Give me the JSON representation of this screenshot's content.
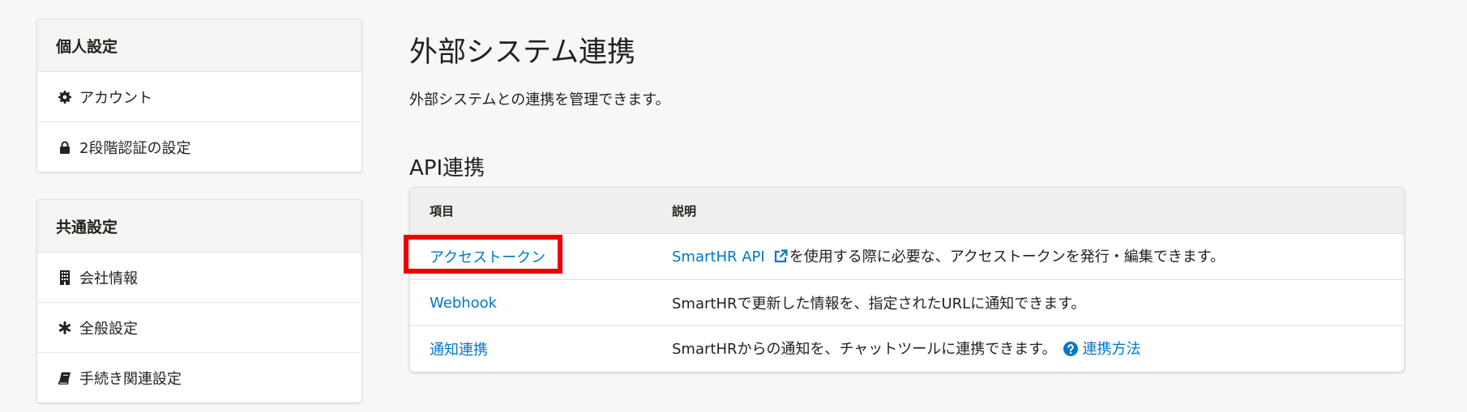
{
  "sidebar": {
    "personal": {
      "header": "個人設定",
      "items": [
        {
          "label": "アカウント",
          "icon": "gear-icon"
        },
        {
          "label": "2段階認証の設定",
          "icon": "lock-icon"
        }
      ]
    },
    "common": {
      "header": "共通設定",
      "items": [
        {
          "label": "会社情報",
          "icon": "building-icon"
        },
        {
          "label": "全般設定",
          "icon": "asterisk-icon"
        },
        {
          "label": "手続き関連設定",
          "icon": "book-icon"
        }
      ]
    }
  },
  "main": {
    "title": "外部システム連携",
    "description": "外部システムとの連携を管理できます。",
    "section_title": "API連携",
    "table": {
      "headers": [
        "項目",
        "説明"
      ],
      "rows": [
        {
          "item": "アクセストークン",
          "link": "SmartHR API",
          "desc": "を使用する際に必要な、アクセストークンを発行・編集できます。"
        },
        {
          "item": "Webhook",
          "desc": "SmartHRで更新した情報を、指定されたURLに通知できます。"
        },
        {
          "item": "通知連携",
          "desc": "SmartHRからの通知を、チャットツールに連携できます。",
          "help_link": "連携方法"
        }
      ]
    }
  },
  "colors": {
    "link": "#0077c7",
    "highlight": "#ee0000",
    "background": "#f8f7f6"
  }
}
